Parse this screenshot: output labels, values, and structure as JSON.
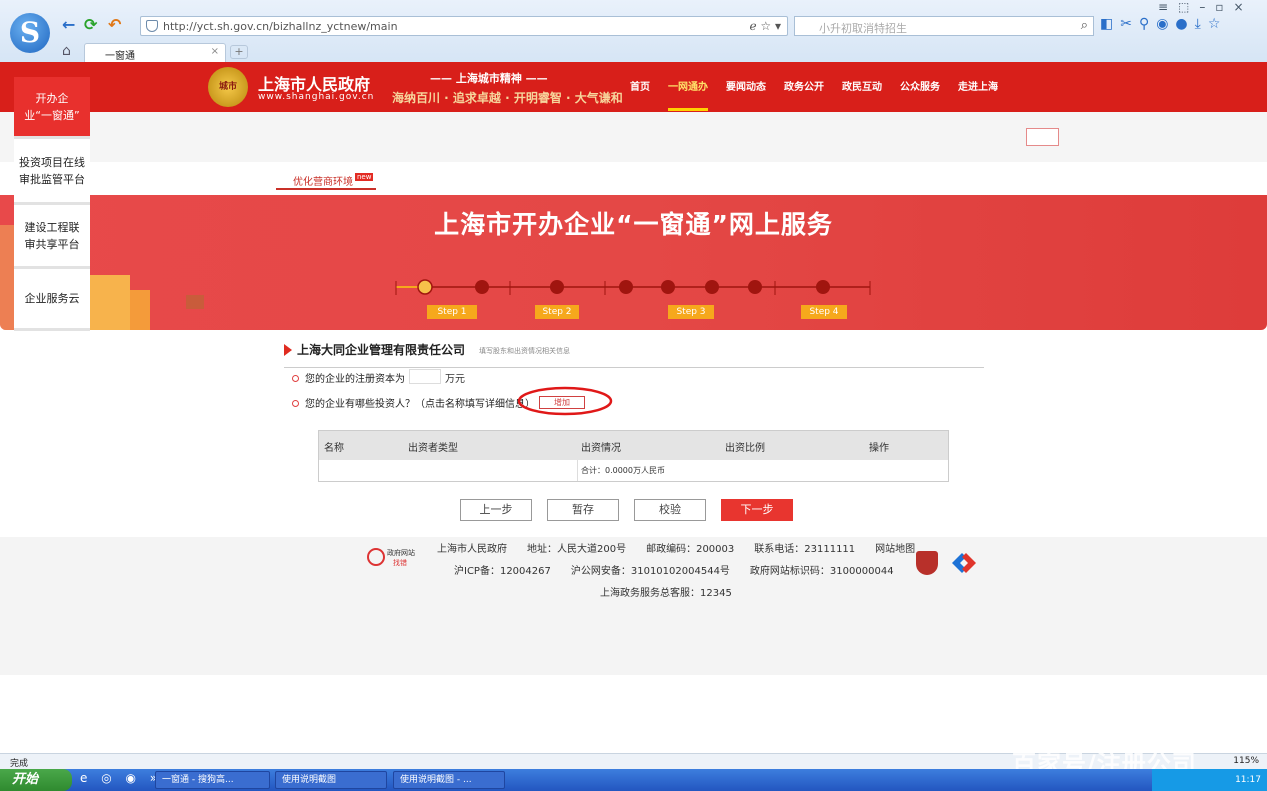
{
  "browser": {
    "url": "http://yct.sh.gov.cn/bizhallnz_yctnew/main",
    "search_placeholder": "小升初取消特招生",
    "tab_title": "一窗通",
    "new_tab": "+",
    "close": "×"
  },
  "header": {
    "gov_name": "上海市人民政府",
    "gov_url": "www.shanghai.gov.cn",
    "emblem_text": "城市",
    "spirit_title": "—— 上海城市精神 ——",
    "spirit_slogan": "海纳百川 · 追求卓越 · 开明睿智 · 大气谦和",
    "nav": [
      "首页",
      "一网通办",
      "要闻动态",
      "政务公开",
      "政民互动",
      "公众服务",
      "走进上海"
    ]
  },
  "sidebar": [
    "开办企业“一窗通”",
    "投资项目在线审批监管平台",
    "建设工程联审共享平台",
    "企业服务云"
  ],
  "sub": {
    "tab": "优化营商环境",
    "badge": "new"
  },
  "banner": {
    "title": "上海市开办企业“一窗通”网上服务",
    "steps": [
      "Step 1",
      "Step 2",
      "Step 3",
      "Step 4"
    ]
  },
  "form": {
    "company": "上海大同企业管理有限责任公司",
    "hint": "填写股东和出资情况相关信息",
    "q1": "您的企业的注册资本为",
    "q1_unit": "万元",
    "q2": "您的企业有哪些投资人？（点击名称填写详细信息）",
    "add": "增加",
    "table_headers": [
      "名称",
      "出资者类型",
      "出资情况",
      "出资比例",
      "操作"
    ],
    "total": "合计：0.0000万人民币",
    "buttons": [
      "上一步",
      "暂存",
      "校验",
      "下一步"
    ]
  },
  "footer": {
    "badge_top": "政府网站",
    "badge_bottom": "找错",
    "line1": "上海市人民政府　　地址：人民大道200号　　邮政编码：200003　　联系电话：23111111　　网站地图",
    "line2": "沪ICP备：12004267　　沪公网安备：31010102004544号　　政府网站标识码：3100000044",
    "line3": "上海政务服务总客服：12345"
  },
  "status": {
    "text": "完成",
    "zoom": "115%"
  },
  "watermark": "百家号/注册公司",
  "taskbar": {
    "start": "开始",
    "items": [
      "一窗通 - 搜狗高...",
      "使用说明截图",
      "使用说明截图 - ..."
    ],
    "time": "11:17"
  },
  "colors": {
    "red": "#d81f1a",
    "step": "#f6a81c",
    "darkred": "#a0150f"
  }
}
